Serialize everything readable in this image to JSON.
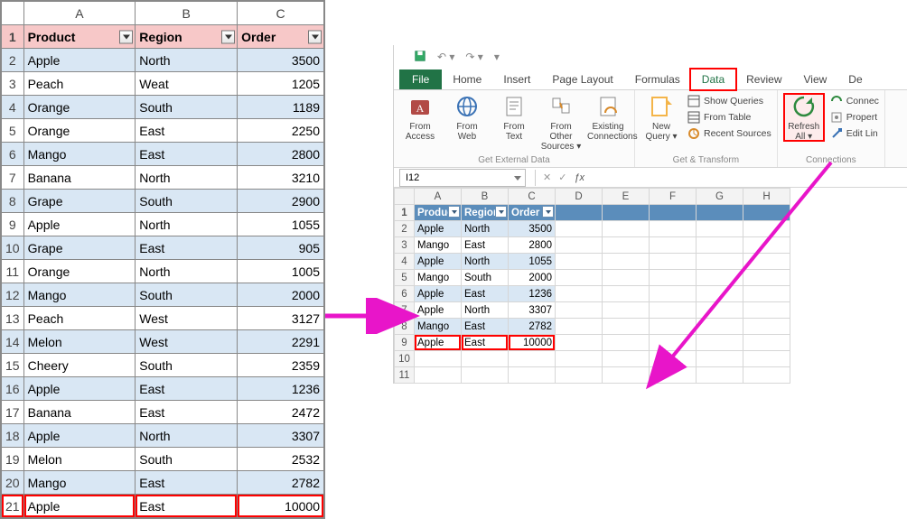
{
  "left_table": {
    "columns": [
      "A",
      "B",
      "C"
    ],
    "headers": [
      "Product",
      "Region",
      "Order"
    ],
    "rows": [
      {
        "n": 2,
        "product": "Apple",
        "region": "North",
        "order": 3500,
        "band": true
      },
      {
        "n": 3,
        "product": "Peach",
        "region": "Weat",
        "order": 1205,
        "band": false
      },
      {
        "n": 4,
        "product": "Orange",
        "region": "South",
        "order": 1189,
        "band": true
      },
      {
        "n": 5,
        "product": "Orange",
        "region": "East",
        "order": 2250,
        "band": false
      },
      {
        "n": 6,
        "product": "Mango",
        "region": "East",
        "order": 2800,
        "band": true
      },
      {
        "n": 7,
        "product": "Banana",
        "region": "North",
        "order": 3210,
        "band": false
      },
      {
        "n": 8,
        "product": "Grape",
        "region": "South",
        "order": 2900,
        "band": true
      },
      {
        "n": 9,
        "product": "Apple",
        "region": "North",
        "order": 1055,
        "band": false
      },
      {
        "n": 10,
        "product": "Grape",
        "region": "East",
        "order": 905,
        "band": true
      },
      {
        "n": 11,
        "product": "Orange",
        "region": "North",
        "order": 1005,
        "band": false
      },
      {
        "n": 12,
        "product": "Mango",
        "region": "South",
        "order": 2000,
        "band": true
      },
      {
        "n": 13,
        "product": "Peach",
        "region": "West",
        "order": 3127,
        "band": false
      },
      {
        "n": 14,
        "product": "Melon",
        "region": "West",
        "order": 2291,
        "band": true
      },
      {
        "n": 15,
        "product": "Cheery",
        "region": "South",
        "order": 2359,
        "band": false
      },
      {
        "n": 16,
        "product": "Apple",
        "region": "East",
        "order": 1236,
        "band": true
      },
      {
        "n": 17,
        "product": "Banana",
        "region": "East",
        "order": 2472,
        "band": false
      },
      {
        "n": 18,
        "product": "Apple",
        "region": "North",
        "order": 3307,
        "band": true
      },
      {
        "n": 19,
        "product": "Melon",
        "region": "South",
        "order": 2532,
        "band": false
      },
      {
        "n": 20,
        "product": "Mango",
        "region": "East",
        "order": 2782,
        "band": true
      },
      {
        "n": 21,
        "product": "Apple",
        "region": "East",
        "order": 10000,
        "band": false,
        "red": true
      }
    ]
  },
  "ribbon": {
    "tabs": [
      "File",
      "Home",
      "Insert",
      "Page Layout",
      "Formulas",
      "Data",
      "Review",
      "View",
      "De"
    ],
    "active_tab": "Data",
    "file_tab": "File",
    "groups": {
      "external": {
        "label": "Get External Data",
        "buttons": [
          {
            "id": "from-access",
            "line1": "From",
            "line2": "Access"
          },
          {
            "id": "from-web",
            "line1": "From",
            "line2": "Web"
          },
          {
            "id": "from-text",
            "line1": "From",
            "line2": "Text"
          },
          {
            "id": "from-other",
            "line1": "From Other",
            "line2": "Sources ▾"
          },
          {
            "id": "existing-conn",
            "line1": "Existing",
            "line2": "Connections"
          }
        ]
      },
      "transform": {
        "label": "Get & Transform",
        "new_query": {
          "line1": "New",
          "line2": "Query ▾"
        },
        "items": [
          "Show Queries",
          "From Table",
          "Recent Sources"
        ]
      },
      "connections": {
        "label": "Connections",
        "refresh": {
          "line1": "Refresh",
          "line2": "All ▾"
        },
        "items": [
          "Connec",
          "Propert",
          "Edit Lin"
        ]
      }
    }
  },
  "namebox": "I12",
  "grid2": {
    "columns": [
      "A",
      "B",
      "C",
      "D",
      "E",
      "F",
      "G",
      "H"
    ],
    "headers": [
      "Product",
      "Region",
      "Order"
    ],
    "rows": [
      {
        "n": 2,
        "product": "Apple",
        "region": "North",
        "order": 3500,
        "band": true
      },
      {
        "n": 3,
        "product": "Mango",
        "region": "East",
        "order": 2800,
        "band": false
      },
      {
        "n": 4,
        "product": "Apple",
        "region": "North",
        "order": 1055,
        "band": true
      },
      {
        "n": 5,
        "product": "Mango",
        "region": "South",
        "order": 2000,
        "band": false
      },
      {
        "n": 6,
        "product": "Apple",
        "region": "East",
        "order": 1236,
        "band": true
      },
      {
        "n": 7,
        "product": "Apple",
        "region": "North",
        "order": 3307,
        "band": false
      },
      {
        "n": 8,
        "product": "Mango",
        "region": "East",
        "order": 2782,
        "band": true
      },
      {
        "n": 9,
        "product": "Apple",
        "region": "East",
        "order": 10000,
        "band": false,
        "red": true
      }
    ],
    "empty_rows": [
      10,
      11
    ]
  }
}
